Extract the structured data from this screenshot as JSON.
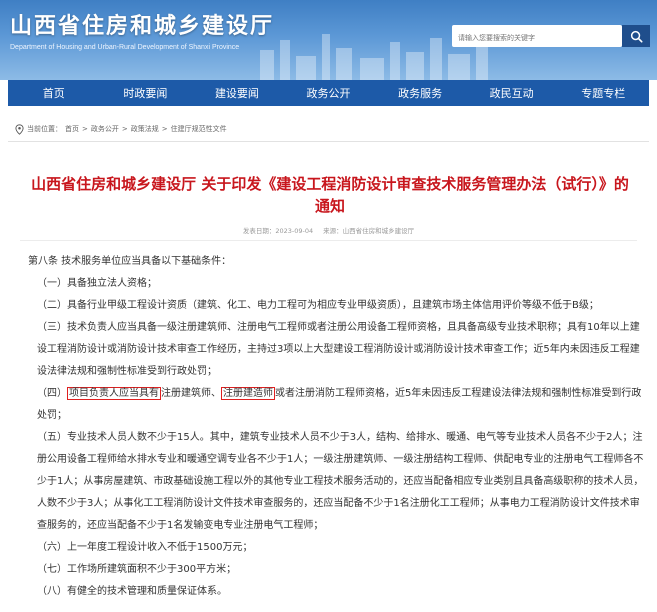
{
  "header": {
    "title": "山西省住房和城乡建设厅",
    "subtitle": "Department of Housing and Urban-Rural Development of Shanxi Province",
    "search_placeholder": "请输入您要搜索的关键字"
  },
  "nav": [
    "首页",
    "时政要闻",
    "建设要闻",
    "政务公开",
    "政务服务",
    "政民互动",
    "专题专栏"
  ],
  "breadcrumb": {
    "label": "当前位置：",
    "items": [
      "首页",
      "政务公开",
      "政策法规",
      "住建厅规范性文件"
    ],
    "sep": ">"
  },
  "article": {
    "title": "山西省住房和城乡建设厅 关于印发《建设工程消防设计审查技术服务管理办法（试行）》的通知",
    "date": "发表日期：2023-09-04",
    "source": "来源：山西省住房和城乡建设厅",
    "intro": "第八条  技术服务单位应当具备以下基础条件：",
    "c1": "（一）具备独立法人资格；",
    "c2": "（二）具备行业甲级工程设计资质（建筑、化工、电力工程可为相应专业甲级资质），且建筑市场主体信用评价等级不低于B级；",
    "c3": "（三）技术负责人应当具备一级注册建筑师、注册电气工程师或者注册公用设备工程师资格，且具备高级专业技术职称；具有10年以上建设工程消防设计或消防设计技术审查工作经历，主持过3项以上大型建设工程消防设计或消防设计技术审查工作；近5年内未因违反工程建设法律法规和强制性标准受到行政处罚；",
    "c4a": "（四）",
    "c4b": "项目负责人应当具有",
    "c4c": "注册建筑师、",
    "c4d": "注册建造师",
    "c4e": "或者注册消防工程师资格，近5年未因违反工程建设法律法规和强制性标准受到行政处罚；",
    "c5": "（五）专业技术人员人数不少于15人。其中，建筑专业技术人员不少于3人，结构、给排水、暖通、电气等专业技术人员各不少于2人；注册公用设备工程师给水排水专业和暖通空调专业各不少于1人；一级注册建筑师、一级注册结构工程师、供配电专业的注册电气工程师各不少于1人；从事房屋建筑、市政基础设施工程以外的其他专业工程技术服务活动的，还应当配备相应专业类别且具备高级职称的技术人员，人数不少于3人；从事化工工程消防设计文件技术审查服务的，还应当配备不少于1名注册化工工程师；从事电力工程消防设计文件技术审查服务的，还应当配备不少于1名发输变电专业注册电气工程师；",
    "c6": "（六）上一年度工程设计收入不低于1500万元；",
    "c7": "（七）工作场所建筑面积不少于300平方米；",
    "c8": "（八）有健全的技术管理和质量保证体系。"
  },
  "colors": {
    "nav_bg": "#1d5aa8",
    "title_red": "#c8161d",
    "highlight_box": "#e02020"
  }
}
